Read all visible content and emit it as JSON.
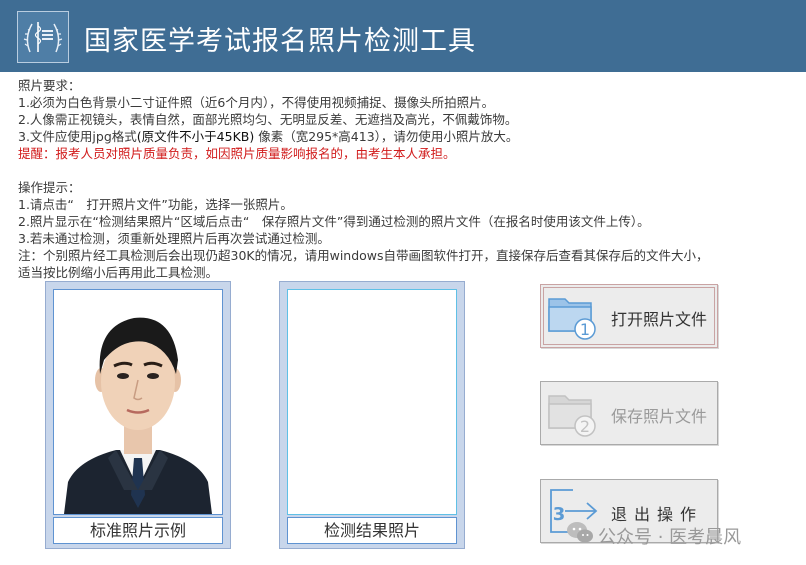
{
  "header": {
    "title": "国家医学考试报名照片检测工具",
    "logo_icon": "medical-exam-logo"
  },
  "requirements": {
    "heading": "照片要求：",
    "line1": "1.必须为白色背景小二寸证件照（近6个月内），不得使用视频捕捉、摄像头所拍照片。",
    "line2": "2.人像需正视镜头，表情自然，面部光照均匀、无明显反差、无遮挡及高光，不佩戴饰物。",
    "line3_pre": "3.文件应使用jpg格式",
    "line3_note": "(原文件不小于45KB)",
    "line3_post": " 像素（宽295*高413），请勿使用小照片放大。",
    "warning": "提醒：报考人员对照片质量负责，如因照片质量影响报名的，由考生本人承担。"
  },
  "steps": {
    "heading": "操作提示：",
    "line1": "1.请点击“　打开照片文件”功能，选择一张照片。",
    "line2": "2.照片显示在“检测结果照片“区域后点击“　保存照片文件”得到通过检测的照片文件（在报名时使用该文件上传）。",
    "line3": "3.若未通过检测，须重新处理照片后再次尝试通过检测。",
    "note1": "注：个别照片经工具检测后会出现仍超30K的情况，请用windows自带画图软件打开，直接保存后查看其保存后的文件大小，",
    "note2": "适当按比例缩小后再用此工具检测。"
  },
  "panels": {
    "sample_caption": "标准照片示例",
    "result_caption": "检测结果照片"
  },
  "buttons": {
    "open": {
      "label": "打开照片文件",
      "number": "1",
      "icon": "folder-icon"
    },
    "save": {
      "label": "保存照片文件",
      "number": "2",
      "icon": "folder-icon"
    },
    "exit": {
      "label": "退出操作",
      "number": "3",
      "icon": "exit-arrow-icon"
    }
  },
  "watermark": {
    "text": "公众号 · 医考晨风",
    "icon": "wechat-icon"
  },
  "colors": {
    "title_bar": "#3f6d94",
    "warning_red": "#d11b1b",
    "panel_bg": "#c8d6eb",
    "frame_blue": "#5f93d1",
    "icon_blue": "#5b9bd5"
  }
}
